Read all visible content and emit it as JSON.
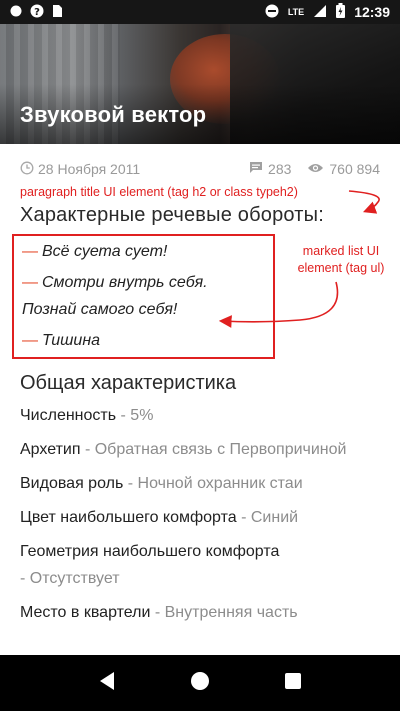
{
  "status_bar": {
    "time": "12:39",
    "network": "LTE",
    "icons": [
      "notification-dot-icon",
      "wifi-question-icon",
      "sim-card-icon",
      "do-not-disturb-icon",
      "signal-icon",
      "battery-charging-icon"
    ]
  },
  "header": {
    "title": "Звуковой вектор"
  },
  "meta": {
    "date": "28 Ноября 2011",
    "comments": "283",
    "views": "760 894"
  },
  "annotations": {
    "title_note": "paragraph title UI element (tag h2 or class typeh2)",
    "list_note_line1": "marked list UI",
    "list_note_line2": "element (tag ul)",
    "color": "#e02020"
  },
  "speech": {
    "heading": "Характерные речевые обороты:",
    "items": [
      "Всё суета сует!",
      "Смотри внутрь себя.",
      "Познай самого себя!",
      "Тишина"
    ]
  },
  "general": {
    "heading": "Общая характеристика",
    "props": [
      {
        "label": "Численность",
        "sep": " - ",
        "value": "5%"
      },
      {
        "label": "Архетип",
        "sep": " - ",
        "value": "Обратная связь с Первопричиной"
      },
      {
        "label": "Видовая роль",
        "sep": " - ",
        "value": "Ночной охранник стаи"
      },
      {
        "label": "Цвет наибольшего комфорта",
        "sep": " - ",
        "value": "Синий"
      },
      {
        "label": "Геометрия наибольшего комфорта",
        "sep": " - ",
        "value": "Отсутствует"
      },
      {
        "label": "Место в квартели",
        "sep": " - ",
        "value": "Внутренняя часть"
      }
    ]
  },
  "nav": {
    "buttons": [
      "back-icon",
      "home-icon",
      "recents-icon"
    ]
  },
  "colors": {
    "accent_dash": "#e5482a",
    "muted": "#8c8c8c"
  }
}
